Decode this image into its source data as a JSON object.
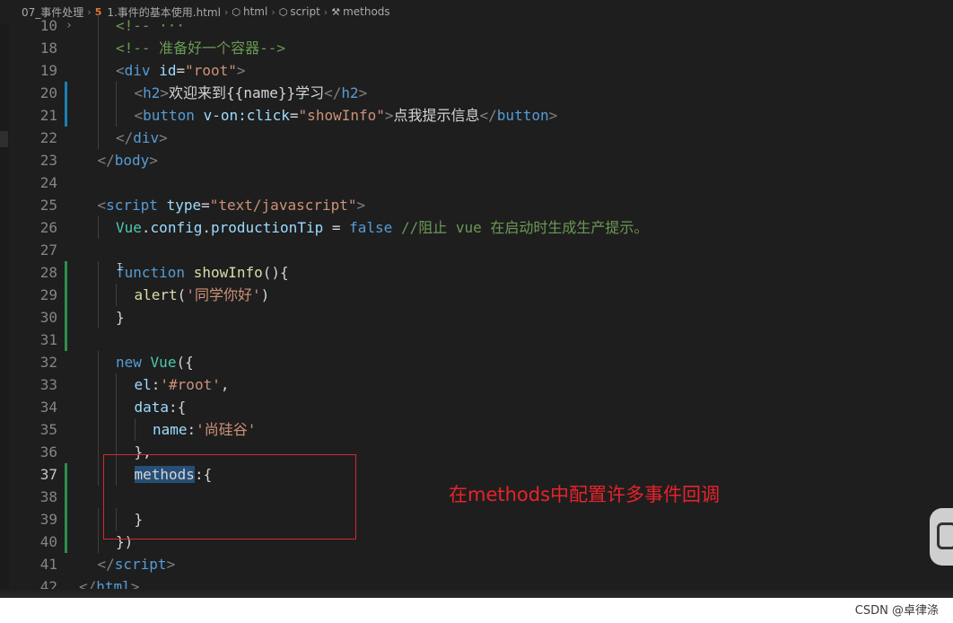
{
  "breadcrumb": {
    "folder": "07_事件处理",
    "file": "1.事件的基本使用.html",
    "crumbs": [
      "html",
      "script",
      "methods"
    ]
  },
  "code_lines": [
    {
      "n": "10",
      "tokens": [
        [
          "cm",
          "<!-- ···"
        ]
      ],
      "indent": 2,
      "fold": true
    },
    {
      "n": "18",
      "tokens": [
        [
          "cm",
          "<!-- 准备好一个容器-->"
        ]
      ],
      "indent": 2
    },
    {
      "n": "19",
      "tokens": [
        [
          "punc",
          "<"
        ],
        [
          "tag",
          "div"
        ],
        [
          "txt",
          " "
        ],
        [
          "attr",
          "id"
        ],
        [
          "txt",
          "="
        ],
        [
          "str",
          "\"root\""
        ],
        [
          "punc",
          ">"
        ]
      ],
      "indent": 2
    },
    {
      "n": "20",
      "tokens": [
        [
          "punc",
          "<"
        ],
        [
          "tag",
          "h2"
        ],
        [
          "punc",
          ">"
        ],
        [
          "txt",
          "欢迎来到{{name}}学习"
        ],
        [
          "punc",
          "</"
        ],
        [
          "tag",
          "h2"
        ],
        [
          "punc",
          ">"
        ]
      ],
      "indent": 3,
      "mark": "blue"
    },
    {
      "n": "21",
      "tokens": [
        [
          "punc",
          "<"
        ],
        [
          "tag",
          "button"
        ],
        [
          "txt",
          " "
        ],
        [
          "attr",
          "v-on:click"
        ],
        [
          "txt",
          "="
        ],
        [
          "str",
          "\"showInfo\""
        ],
        [
          "punc",
          ">"
        ],
        [
          "txt",
          "点我提示信息"
        ],
        [
          "punc",
          "</"
        ],
        [
          "tag",
          "button"
        ],
        [
          "punc",
          ">"
        ]
      ],
      "indent": 3,
      "mark": "blue"
    },
    {
      "n": "22",
      "tokens": [
        [
          "punc",
          "</"
        ],
        [
          "tag",
          "div"
        ],
        [
          "punc",
          ">"
        ]
      ],
      "indent": 2
    },
    {
      "n": "23",
      "tokens": [
        [
          "punc",
          "</"
        ],
        [
          "tag",
          "body"
        ],
        [
          "punc",
          ">"
        ]
      ],
      "indent": 1
    },
    {
      "n": "24",
      "tokens": [],
      "indent": 0
    },
    {
      "n": "25",
      "tokens": [
        [
          "punc",
          "<"
        ],
        [
          "tag",
          "script"
        ],
        [
          "txt",
          " "
        ],
        [
          "attr",
          "type"
        ],
        [
          "txt",
          "="
        ],
        [
          "str",
          "\"text/javascript\""
        ],
        [
          "punc",
          ">"
        ]
      ],
      "indent": 1
    },
    {
      "n": "26",
      "tokens": [
        [
          "cls",
          "Vue"
        ],
        [
          "txt",
          "."
        ],
        [
          "prop",
          "config"
        ],
        [
          "txt",
          "."
        ],
        [
          "prop",
          "productionTip"
        ],
        [
          "op",
          " = "
        ],
        [
          "kw",
          "false"
        ],
        [
          "txt",
          " "
        ],
        [
          "cm",
          "//阻止 vue 在启动时生成生产提示。"
        ]
      ],
      "indent": 2
    },
    {
      "n": "27",
      "tokens": [],
      "indent": 0
    },
    {
      "n": "28",
      "tokens": [
        [
          "kw",
          "function"
        ],
        [
          "txt",
          " "
        ],
        [
          "fn",
          "showInfo"
        ],
        [
          "txt",
          "(){"
        ]
      ],
      "indent": 2,
      "mark": "green"
    },
    {
      "n": "29",
      "tokens": [
        [
          "fn",
          "alert"
        ],
        [
          "txt",
          "("
        ],
        [
          "str",
          "'同学你好'"
        ],
        [
          "txt",
          ")"
        ]
      ],
      "indent": 3,
      "mark": "green"
    },
    {
      "n": "30",
      "tokens": [
        [
          "txt",
          "}"
        ]
      ],
      "indent": 2,
      "mark": "green"
    },
    {
      "n": "31",
      "tokens": [],
      "indent": 0,
      "mark": "green"
    },
    {
      "n": "32",
      "tokens": [
        [
          "kw",
          "new"
        ],
        [
          "txt",
          " "
        ],
        [
          "cls",
          "Vue"
        ],
        [
          "txt",
          "({"
        ]
      ],
      "indent": 2
    },
    {
      "n": "33",
      "tokens": [
        [
          "prop",
          "el"
        ],
        [
          "txt",
          ":"
        ],
        [
          "str",
          "'#root'"
        ],
        [
          "txt",
          ","
        ]
      ],
      "indent": 3
    },
    {
      "n": "34",
      "tokens": [
        [
          "prop",
          "data"
        ],
        [
          "txt",
          ":{"
        ]
      ],
      "indent": 3
    },
    {
      "n": "35",
      "tokens": [
        [
          "prop",
          "name"
        ],
        [
          "txt",
          ":"
        ],
        [
          "str",
          "'尚硅谷'"
        ]
      ],
      "indent": 4
    },
    {
      "n": "36",
      "tokens": [
        [
          "txt",
          "},"
        ]
      ],
      "indent": 3
    },
    {
      "n": "37",
      "tokens": [
        [
          "sel",
          "methods"
        ],
        [
          "txt",
          ":{"
        ]
      ],
      "indent": 3,
      "active": true,
      "mark": "green"
    },
    {
      "n": "38",
      "tokens": [],
      "indent": 0,
      "mark": "green"
    },
    {
      "n": "39",
      "tokens": [
        [
          "txt",
          "}"
        ]
      ],
      "indent": 3,
      "mark": "green"
    },
    {
      "n": "40",
      "tokens": [
        [
          "txt",
          "})"
        ]
      ],
      "indent": 2,
      "mark": "green"
    },
    {
      "n": "41",
      "tokens": [
        [
          "punc",
          "</"
        ],
        [
          "tag",
          "script"
        ],
        [
          "punc",
          ">"
        ]
      ],
      "indent": 1
    },
    {
      "n": "42",
      "tokens": [
        [
          "punc",
          "</"
        ],
        [
          "tag",
          "html"
        ],
        [
          "punc",
          ">"
        ]
      ],
      "indent": 0
    }
  ],
  "annotation": {
    "text": "在methods中配置许多事件回调",
    "color": "#e8232a"
  },
  "watermark": "CSDN @卓律涤",
  "colors": {
    "editor_bg": "#1e1e1e",
    "tag": "#569cd6",
    "attribute": "#9cdcfe",
    "string": "#ce9178",
    "comment": "#6a9955",
    "function": "#dcdcaa",
    "selection": "#264f78"
  }
}
